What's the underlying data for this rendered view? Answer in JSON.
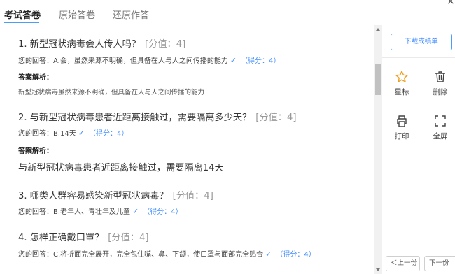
{
  "tabs": [
    {
      "label": "考试答卷",
      "active": true
    },
    {
      "label": "原始答卷",
      "active": false
    },
    {
      "label": "还原作答",
      "active": false
    }
  ],
  "close_label": "×",
  "questions": [
    {
      "title": "1. 新型冠状病毒会人传人吗？",
      "score": "[分值：4]",
      "answer": "您的回答：A.会，虽然来源不明确，但具备在人与人之间传播的能力",
      "gain": "（得分：4）",
      "explanation_label": "答案解析：",
      "explanation": "新型冠状病毒虽然来源不明确，但具备在人与人之间传播的能力"
    },
    {
      "title": "2. 与新型冠状病毒患者近距离接触过，需要隔离多少天？",
      "score": "[分值：4]",
      "answer": "您的回答：B.14天",
      "gain": "（得分：4）",
      "explanation_label": "答案解析：",
      "explanation": "与新型冠状病毒患者近距离接触过，需要隔离14天"
    },
    {
      "title": "3. 哪类人群容易感染新型冠状病毒？",
      "score": "[分值：4]",
      "answer": "您的回答：B.老年人、青壮年及儿童",
      "gain": "（得分：4）"
    },
    {
      "title": "4. 怎样正确戴口罩？",
      "score": "[分值：4]",
      "answer": "您的回答：C.将折面完全展开，完全包住嘴、鼻、下颌，使口罩与面部完全贴合",
      "gain": "（得分：4）"
    }
  ],
  "sidebar": {
    "download_label": "下载成绩单",
    "tools": [
      {
        "label": "星标",
        "icon": "star-icon"
      },
      {
        "label": "删除",
        "icon": "trash-icon"
      },
      {
        "label": "打印",
        "icon": "printer-icon"
      },
      {
        "label": "全屏",
        "icon": "fullscreen-icon"
      }
    ],
    "prev_label": "＜上一份",
    "next_label": "下一份"
  },
  "colors": {
    "accent": "#3f8cff",
    "tab_underline": "#4a9df8"
  }
}
